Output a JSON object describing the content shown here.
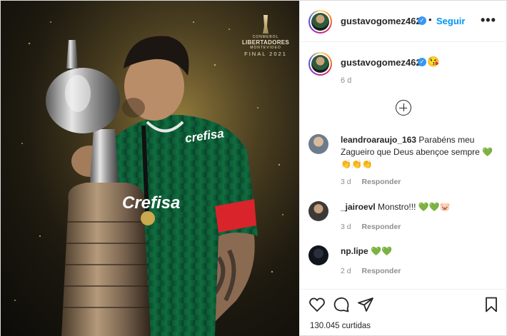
{
  "post": {
    "logo": {
      "line1": "CONMEBOL",
      "line2": "LIBERTADORES",
      "line3": "MONTEVIDEO",
      "line4": "FINAL 2021"
    },
    "jersey_sponsor": "crefisa",
    "jersey_chest": "Crefisa"
  },
  "header": {
    "username": "gustavogomez462",
    "verified_symbol": "✓",
    "dot": "•",
    "follow_label": "Seguir",
    "more_label": "•••"
  },
  "caption": {
    "username": "gustavogomez462",
    "emoji": "😘",
    "time": "6 d"
  },
  "comments": [
    {
      "username": "leandroaraujo_163",
      "text": "Parabéns meu Zagueiro que Deus abençoe sempre 💚 👏👏👏",
      "time": "3 d",
      "reply_label": "Responder",
      "avatar_color": "#6d7b8c"
    },
    {
      "username": "_jairoevl",
      "text": "Monstro!!! 💚💚🐷",
      "time": "3 d",
      "reply_label": "Responder",
      "avatar_color": "#3c3a36"
    },
    {
      "username": "np.lipe",
      "text": "💚💚",
      "time": "2 d",
      "reply_label": "Responder",
      "avatar_color": "#2a2f3b"
    }
  ],
  "actions": {
    "likes_text": "130.045 curtidas"
  },
  "colors": {
    "accent": "#0095f6",
    "verified": "#3897f0",
    "muted": "#8e8e8e",
    "jersey": "#0f6b3c"
  }
}
